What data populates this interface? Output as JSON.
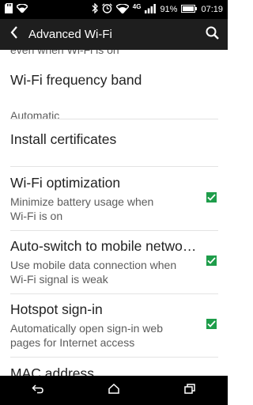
{
  "status_bar": {
    "battery": "91%",
    "time": "07:19",
    "network": "4G"
  },
  "header": {
    "title": "Advanced Wi-Fi"
  },
  "settings": {
    "partial_text": "even when Wi-Fi is on",
    "frequency_band": {
      "title": "Wi-Fi frequency band",
      "value": "Automatic"
    },
    "install_certificates": {
      "title": "Install certificates"
    },
    "wifi_optimization": {
      "title": "Wi-Fi optimization",
      "summary_line1": "Minimize battery usage when",
      "summary_line2": "Wi-Fi is on",
      "checked": true
    },
    "auto_switch": {
      "title": "Auto-switch to mobile netwo…",
      "summary_line1": "Use mobile data connection when",
      "summary_line2": "Wi-Fi signal is weak",
      "checked": true
    },
    "hotspot_signin": {
      "title": "Hotspot sign-in",
      "summary_line1": "Automatically open sign-in web",
      "summary_line2": "pages for Internet access",
      "checked": true
    },
    "mac_address": {
      "title": "MAC address"
    }
  },
  "colors": {
    "accent": "#1e9d4a",
    "action_bar": "#1e1e1e"
  },
  "icons": {
    "back": "chevron-left-icon",
    "search": "search-icon",
    "nav_back": "back-icon",
    "nav_home": "home-icon",
    "nav_recents": "recents-icon"
  }
}
